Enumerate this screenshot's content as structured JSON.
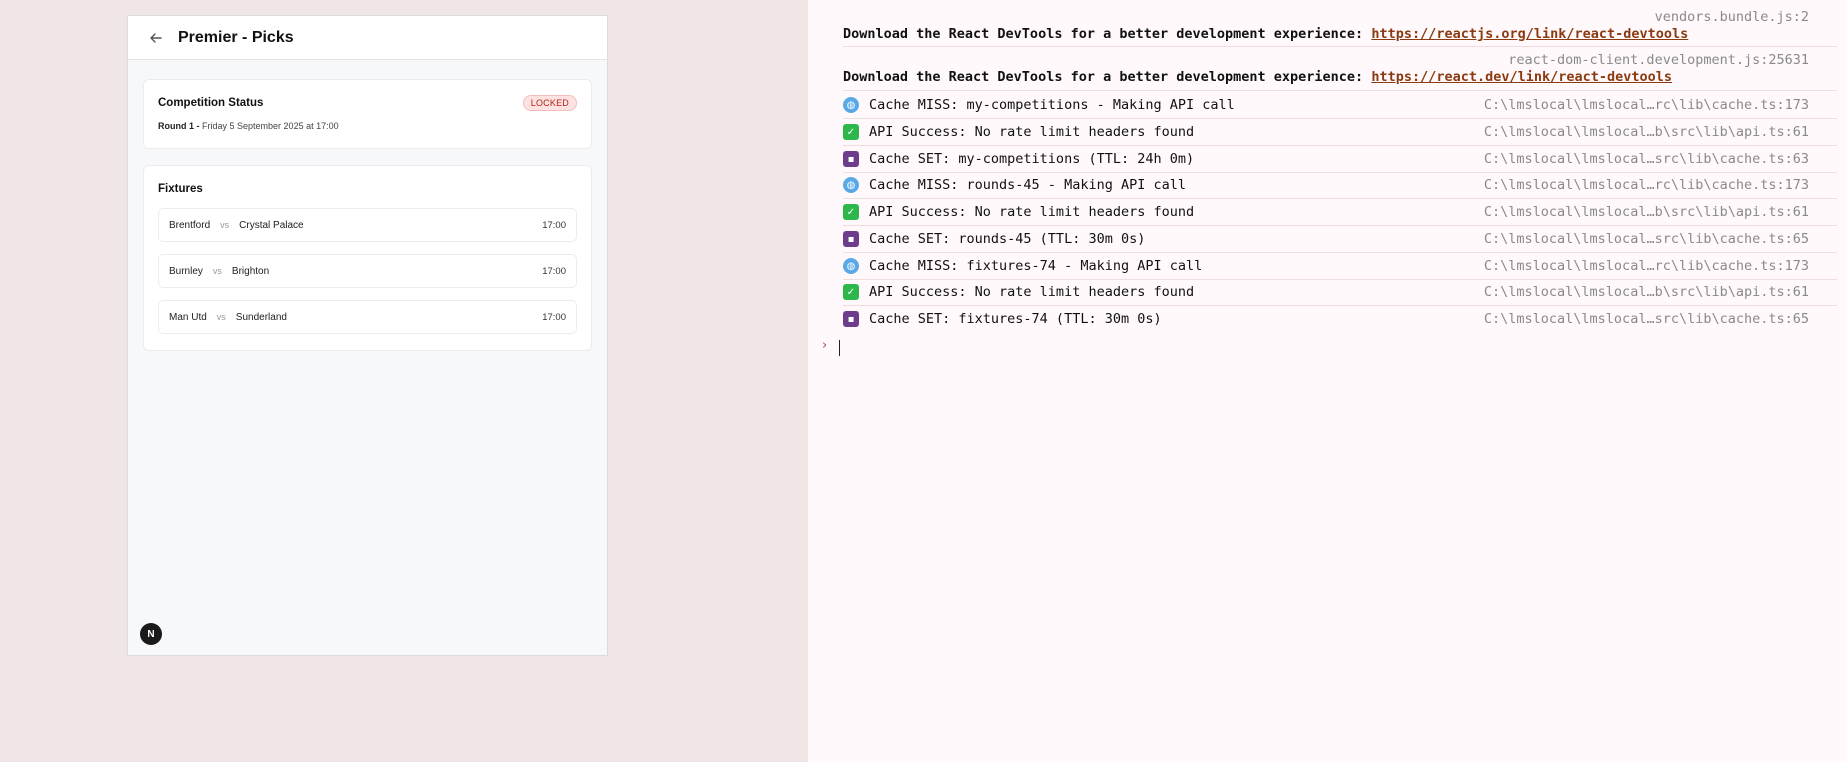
{
  "app": {
    "title": "Premier - Picks",
    "status_card": {
      "title": "Competition Status",
      "badge": "LOCKED",
      "round_label": "Round 1 -",
      "round_date": "Friday 5 September 2025 at 17:00"
    },
    "fixtures": {
      "title": "Fixtures",
      "vs_label": "vs",
      "items": [
        {
          "home": "Brentford",
          "away": "Crystal Palace",
          "time": "17:00"
        },
        {
          "home": "Burnley",
          "away": "Brighton",
          "time": "17:00"
        },
        {
          "home": "Man Utd",
          "away": "Sunderland",
          "time": "17:00"
        }
      ]
    },
    "next_badge": "N"
  },
  "console": {
    "entries": [
      {
        "source": "vendors.bundle.js:2",
        "text": "Download the React DevTools for a better development experience: ",
        "link": "https://reactjs.org/link/react-devtools"
      },
      {
        "source": "react-dom-client.development.js:25631",
        "text": "Download the React DevTools for a better development experience: ",
        "link": "https://react.dev/link/react-devtools"
      }
    ],
    "logs": [
      {
        "icon": "globe-icon",
        "text": "Cache MISS: my-competitions - Making API call",
        "source": "C:\\lmslocal\\lmslocal…rc\\lib\\cache.ts:173"
      },
      {
        "icon": "check-icon",
        "text": "API Success: No rate limit headers found",
        "source": "C:\\lmslocal\\lmslocal…b\\src\\lib\\api.ts:61"
      },
      {
        "icon": "floppy-disk-icon",
        "text": "Cache SET: my-competitions (TTL: 24h 0m)",
        "source": "C:\\lmslocal\\lmslocal…src\\lib\\cache.ts:63"
      },
      {
        "icon": "globe-icon",
        "text": "Cache MISS: rounds-45 - Making API call",
        "source": "C:\\lmslocal\\lmslocal…rc\\lib\\cache.ts:173"
      },
      {
        "icon": "check-icon",
        "text": "API Success: No rate limit headers found",
        "source": "C:\\lmslocal\\lmslocal…b\\src\\lib\\api.ts:61"
      },
      {
        "icon": "floppy-disk-icon",
        "text": "Cache SET: rounds-45 (TTL: 30m 0s)",
        "source": "C:\\lmslocal\\lmslocal…src\\lib\\cache.ts:65"
      },
      {
        "icon": "globe-icon",
        "text": "Cache MISS: fixtures-74 - Making API call",
        "source": "C:\\lmslocal\\lmslocal…rc\\lib\\cache.ts:173"
      },
      {
        "icon": "check-icon",
        "text": "API Success: No rate limit headers found",
        "source": "C:\\lmslocal\\lmslocal…b\\src\\lib\\api.ts:61"
      },
      {
        "icon": "floppy-disk-icon",
        "text": "Cache SET: fixtures-74 (TTL: 30m 0s)",
        "source": "C:\\lmslocal\\lmslocal…src\\lib\\cache.ts:65"
      }
    ],
    "prompt_symbol": "›"
  }
}
